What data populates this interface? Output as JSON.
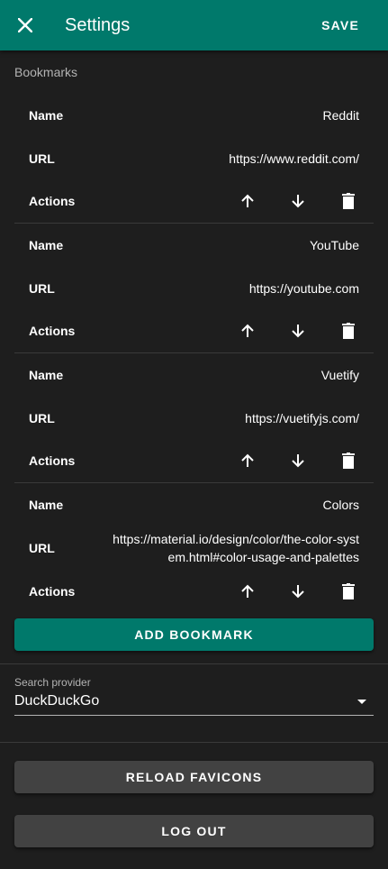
{
  "app_bar": {
    "title": "Settings",
    "save_label": "SAVE",
    "close_icon": "close-icon",
    "color": "#00796b"
  },
  "bookmarks_section": {
    "label": "Bookmarks",
    "name_key": "Name",
    "url_key": "URL",
    "actions_key": "Actions",
    "items": [
      {
        "name": "Reddit",
        "url": "https://www.reddit.com/"
      },
      {
        "name": "YouTube",
        "url": "https://youtube.com"
      },
      {
        "name": "Vuetify",
        "url": "https://vuetifyjs.com/"
      },
      {
        "name": "Colors",
        "url": "https://material.io/design/color/the-color-system.html#color-usage-and-palettes"
      }
    ],
    "action_icons": [
      "arrow-up-icon",
      "arrow-down-icon",
      "delete-icon"
    ],
    "add_label": "ADD BOOKMARK"
  },
  "search": {
    "label": "Search provider",
    "value": "DuckDuckGo"
  },
  "reload_label": "RELOAD FAVICONS",
  "logout_label": "LOG OUT"
}
